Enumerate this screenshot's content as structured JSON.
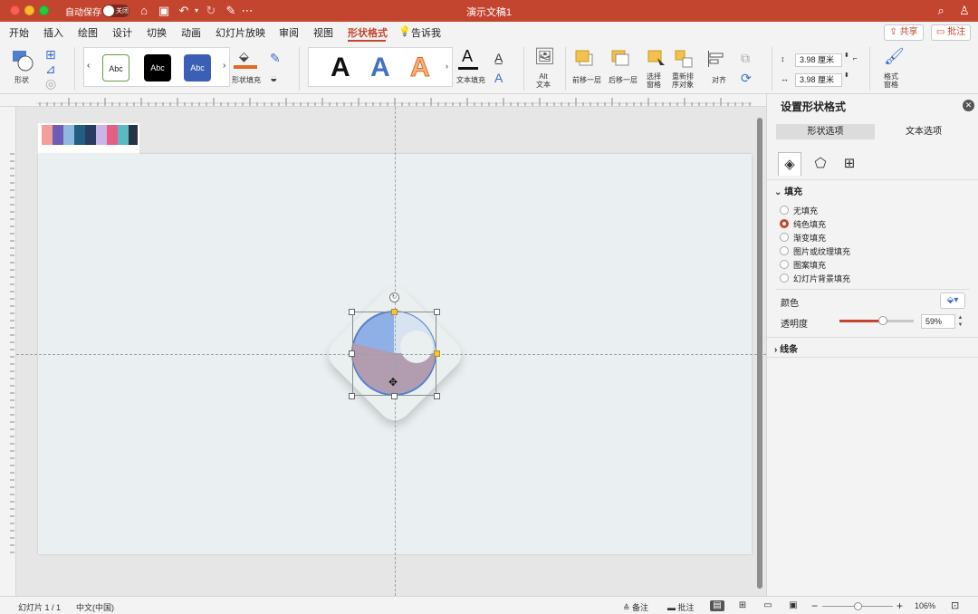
{
  "titlebar": {
    "autosave_label": "自动保存",
    "autosave_state": "关闭",
    "document_title": "演示文稿1",
    "accent": "#c4452f"
  },
  "menu": {
    "tabs": [
      "开始",
      "插入",
      "绘图",
      "设计",
      "切换",
      "动画",
      "幻灯片放映",
      "审阅",
      "视图",
      "形状格式",
      "告诉我"
    ],
    "active_tab": "形状格式",
    "share_label": "共享",
    "comment_label": "批注"
  },
  "ribbon": {
    "shape_label": "形状",
    "style_swatches": [
      "Abc",
      "Abc",
      "Abc"
    ],
    "shape_fill_label": "形状填充",
    "wordart_letters": [
      "A",
      "A",
      "A"
    ],
    "text_fill_label": "文本填充",
    "alt_text_label": "Alt\n文本",
    "bring_forward_label": "前移一层",
    "send_backward_label": "后移一层",
    "selection_pane_label": "选择\n窗格",
    "reorder_label": "重新排\n序对象",
    "align_label": "对齐",
    "height_value": "3.98 厘米",
    "width_value": "3.98 厘米",
    "format_pane_label": "格式\n窗格"
  },
  "palette": {
    "colors": [
      "#f29f9a",
      "#6e5db6",
      "#8fb9e0",
      "#215e7f",
      "#283b63",
      "#c9b6e4",
      "#e85d86",
      "#5bbac1",
      "#263445"
    ]
  },
  "pane": {
    "title": "设置形状格式",
    "segment_shape": "形状选项",
    "segment_text": "文本选项",
    "fill_section": "填充",
    "fill_options": [
      "无填充",
      "纯色填充",
      "渐变填充",
      "图片或纹理填充",
      "图案填充",
      "幻灯片背景填充"
    ],
    "selected_fill": "纯色填充",
    "color_label": "颜色",
    "transparency_label": "透明度",
    "transparency_value": "59%",
    "transparency_fraction": 0.59,
    "line_section": "线条"
  },
  "status": {
    "slide_counter": "幻灯片 1 / 1",
    "language": "中文(中国)",
    "notes_label": "备注",
    "comments_label": "批注",
    "zoom_value": "106%",
    "zoom_fraction": 0.5
  }
}
